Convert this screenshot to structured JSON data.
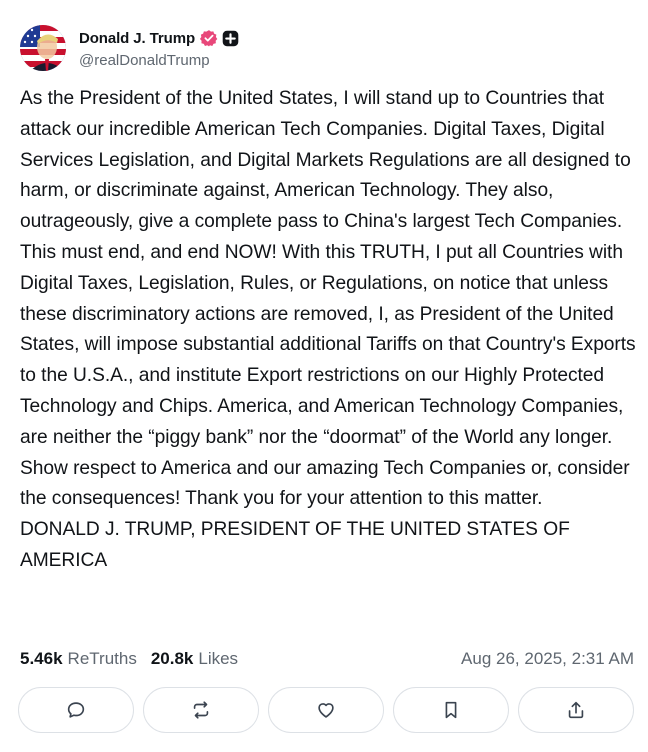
{
  "author": {
    "display_name": "Donald J. Trump",
    "handle": "@realDonaldTrump",
    "verified_badge_icon": "verified-badge-icon",
    "plus_badge_icon": "plus-badge-icon",
    "verified_color": "#e0245e"
  },
  "post": {
    "text": "As the President of the United States, I will stand up to Countries that attack our incredible American Tech Companies. Digital Taxes, Digital Services Legislation, and Digital Markets Regulations are all designed to harm, or discriminate against, American Technology. They also, outrageously, give a complete pass to China's largest Tech Companies. This must end, and end NOW! With this TRUTH, I put all Countries with Digital Taxes, Legislation, Rules, or Regulations, on notice that unless these discriminatory actions are removed, I, as President of the United States, will impose substantial additional Tariffs on that Country's Exports to the U.S.A., and institute Export restrictions on our Highly Protected Technology and Chips. America, and American Technology Companies, are neither the “piggy bank” nor the “doormat” of the World any longer. Show respect to America and our amazing Tech Companies or, consider the consequences! Thank you for your attention to this matter.\nDONALD J. TRUMP, PRESIDENT OF THE UNITED STATES OF AMERICA"
  },
  "stats": {
    "retruths_count": "5.46k",
    "retruths_label": "ReTruths",
    "likes_count": "20.8k",
    "likes_label": "Likes",
    "timestamp": "Aug 26, 2025, 2:31 AM"
  },
  "actions": [
    {
      "name": "reply",
      "icon": "comment-icon"
    },
    {
      "name": "retruth",
      "icon": "repost-icon"
    },
    {
      "name": "like",
      "icon": "heart-icon"
    },
    {
      "name": "bookmark",
      "icon": "bookmark-icon"
    },
    {
      "name": "share",
      "icon": "share-icon"
    }
  ]
}
